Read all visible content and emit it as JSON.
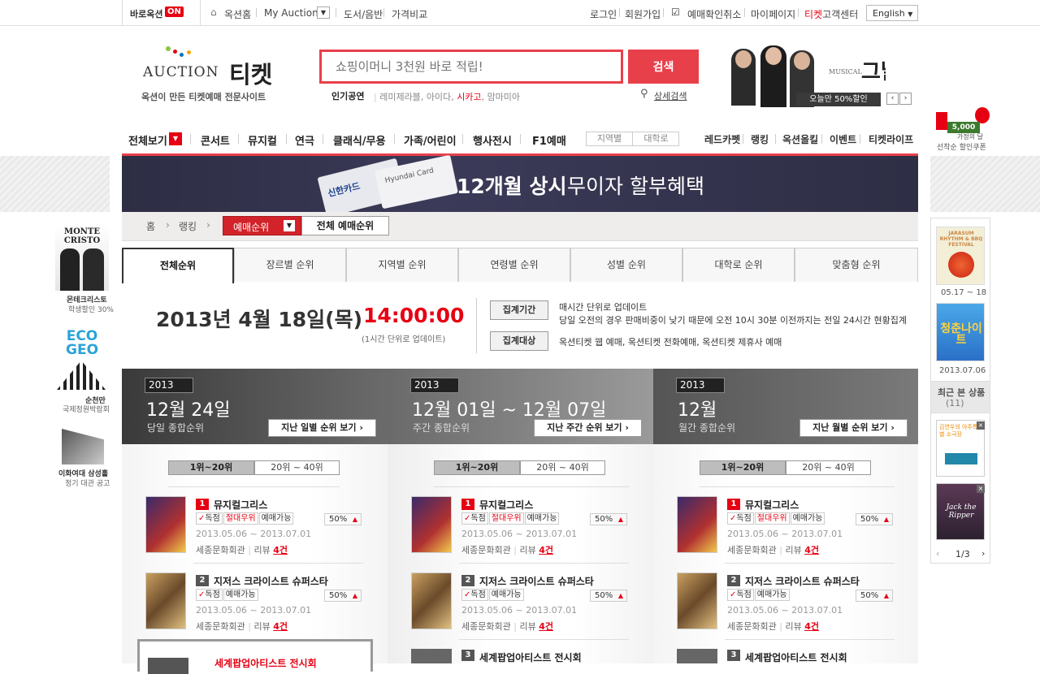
{
  "topbar": {
    "quick": "바로옥션",
    "quick_state": "ON",
    "home": "옥션홈",
    "myauction": "My Auction",
    "books": "도서/음반",
    "compare": "가격비교",
    "login": "로그인",
    "join": "회원가입",
    "cancel": "예매확인취소",
    "mypage": "마이페이지",
    "cs_prefix": "티켓",
    "cs": "고객센터",
    "lang": "English"
  },
  "logo": {
    "brand": "AUCTION",
    "title": "티켓",
    "tagline": "옥션이 만든 티켓예매 전문사이트"
  },
  "search": {
    "placeholder": "쇼핑이머니 3천원 바로 적립!",
    "button": "검색",
    "detail": "상세검색",
    "popular_label": "인기공연",
    "popular": [
      "레미제라블",
      "아이다",
      "시카고",
      "맘마미아"
    ]
  },
  "promo_musical": {
    "small": "MUSICAL",
    "title": "그날들",
    "badge": "오늘만 50%할인"
  },
  "coupon": {
    "amount": "5,000",
    "line1": "가정의 달",
    "line2": "선착순 할인쿠폰"
  },
  "gnb": {
    "all": "전체보기",
    "items": [
      "콘서트",
      "뮤지컬",
      "연극",
      "클래식/무용",
      "가족/어린이",
      "행사전시",
      "F1예매"
    ],
    "filters": [
      "지역별",
      "대학로"
    ],
    "right": [
      "레드카펫",
      "랭킹",
      "옥션올킬",
      "이벤트",
      "티켓라이프"
    ]
  },
  "banner": {
    "card1": "신한카드",
    "card2": "Hyundai Card",
    "bold": "12개월 상시",
    "rest": "무이자 할부혜택"
  },
  "breadcrumb": {
    "home": "홈",
    "ranking": "랭킹",
    "dropdown": "예매순위",
    "total": "전체 예매순위"
  },
  "tabs": [
    "전체순위",
    "장르별 순위",
    "지역별 순위",
    "연령별 순위",
    "성별 순위",
    "대학로 순위",
    "맞춤형 순위"
  ],
  "timestamp": {
    "date": "2013년 4월 18일(목)",
    "time": "14:00:00",
    "note": "(1시간 단위로 업데이트)"
  },
  "info": {
    "period_label": "집계기간",
    "period_line1": "매시간 단위로 업데이트",
    "period_line2": "당일 오전의 경우 판매비중이 낮기 때문에 오전 10시 30분 이전까지는 전일 24시간 현황집계",
    "target_label": "집계대상",
    "target_text": "옥션티켓 웹 예매, 옥션티켓 전화예매, 옥션티켓 제휴사 예매"
  },
  "left_ads": [
    {
      "title": "MONTE CRISTO",
      "l1": "몬테크리스토",
      "l2": "학생할인 30%"
    },
    {
      "title": "ECO GEO",
      "l1": "순천만",
      "l2": "국제정원박람회"
    },
    {
      "title": "",
      "l1": "이화여대 삼성홀",
      "l2": "정기 대관 공고"
    }
  ],
  "right_side": {
    "p1_date": "05.17 ~ 18",
    "p1_title": "JARASUM RHYTHM & BBQ FESTIVAL",
    "p2_date": "2013.07.06",
    "p2_title": "청춘나이트",
    "recent_label": "최근 본 상품",
    "recent_count": "(11)",
    "r1": "김연우의 아주특별 소극장",
    "r2": "Jack the Ripper",
    "page": "1/3"
  },
  "columns": [
    {
      "year": "2013",
      "big": "12월 24일",
      "sub": "당일 종합순위",
      "btn": "지난 일별 순위 보기",
      "ranges": [
        "1위~20위",
        "20위 ~ 40위"
      ]
    },
    {
      "year": "2013",
      "big": "12월 01일 ~ 12월 07일",
      "sub": "주간 종합순위",
      "btn": "지난 주간 순위 보기",
      "ranges": [
        "1위~20위",
        "20위 ~ 40위"
      ]
    },
    {
      "year": "2013",
      "big": "12월",
      "sub": "월간 종합순위",
      "btn": "지난 월별 순위 보기",
      "ranges": [
        "1위~20위",
        "20위 ~ 40위"
      ]
    }
  ],
  "items": [
    {
      "rank": "1",
      "name": "뮤지컬그리스",
      "tags": [
        "독점",
        "절대우위",
        "예매가능"
      ],
      "pct": "50%",
      "date": "2013.05.06 ~ 2013.07.01",
      "venue": "세종문화회관",
      "review_label": "리뷰",
      "reviews": "4건"
    },
    {
      "rank": "2",
      "name": "지저스 크라이스트 슈퍼스타",
      "tags": [
        "독점",
        "예매가능"
      ],
      "pct": "50%",
      "date": "2013.05.06 ~ 2013.07.01",
      "venue": "세종문화회관",
      "review_label": "리뷰",
      "reviews": "4건"
    },
    {
      "rank": "3",
      "name": "세계팝업아티스트 전시회"
    }
  ],
  "colors": {
    "accent": "#e8404b",
    "red": "#e60012"
  }
}
